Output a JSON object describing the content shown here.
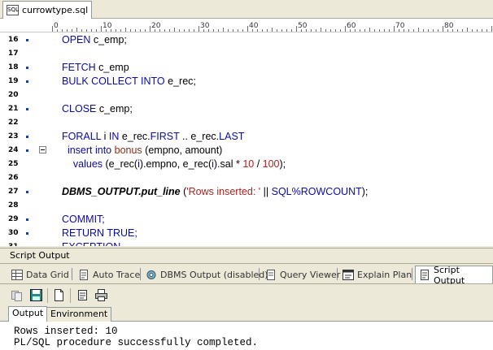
{
  "file_tab": {
    "icon": "sql-file-icon",
    "icon_text": "SQL",
    "label": "currowtype.sql"
  },
  "ruler": {
    "marks": [
      "0",
      "10",
      "20",
      "30",
      "40",
      "50",
      "60",
      "70",
      "80"
    ]
  },
  "editor": {
    "lines": [
      {
        "num": "16",
        "marker": true,
        "fold": false,
        "tokens": [
          {
            "t": "OPEN ",
            "c": "kw"
          },
          {
            "t": "c_emp;",
            "c": "tx"
          }
        ]
      },
      {
        "num": "17",
        "marker": false,
        "fold": false,
        "tokens": []
      },
      {
        "num": "18",
        "marker": true,
        "fold": false,
        "tokens": [
          {
            "t": "FETCH ",
            "c": "kw"
          },
          {
            "t": "c_emp",
            "c": "tx"
          }
        ]
      },
      {
        "num": "19",
        "marker": true,
        "fold": false,
        "tokens": [
          {
            "t": "BULK COLLECT INTO ",
            "c": "kw"
          },
          {
            "t": "e_rec;",
            "c": "tx"
          }
        ]
      },
      {
        "num": "20",
        "marker": false,
        "fold": false,
        "tokens": []
      },
      {
        "num": "21",
        "marker": true,
        "fold": false,
        "tokens": [
          {
            "t": "CLOSE ",
            "c": "kw"
          },
          {
            "t": "c_emp;",
            "c": "tx"
          }
        ]
      },
      {
        "num": "22",
        "marker": false,
        "fold": false,
        "tokens": []
      },
      {
        "num": "23",
        "marker": true,
        "fold": false,
        "tokens": [
          {
            "t": "FORALL ",
            "c": "kw"
          },
          {
            "t": "i ",
            "c": "tx"
          },
          {
            "t": "IN ",
            "c": "kw"
          },
          {
            "t": "e_rec.",
            "c": "tx"
          },
          {
            "t": "FIRST",
            "c": "kw"
          },
          {
            "t": " .. e_rec.",
            "c": "tx"
          },
          {
            "t": "LAST",
            "c": "kw"
          }
        ]
      },
      {
        "num": "24",
        "marker": true,
        "fold": true,
        "tokens": [
          {
            "t": "  insert into ",
            "c": "kw"
          },
          {
            "t": "bonus",
            "c": "fn"
          },
          {
            "t": " (empno, amount)",
            "c": "tx"
          }
        ]
      },
      {
        "num": "25",
        "marker": false,
        "fold": false,
        "tokens": [
          {
            "t": "    values ",
            "c": "kw"
          },
          {
            "t": "(e_rec(",
            "c": "tx"
          },
          {
            "t": "i",
            "c": "kw"
          },
          {
            "t": ").empno, e_rec(",
            "c": "tx"
          },
          {
            "t": "i",
            "c": "kw"
          },
          {
            "t": ").sal * ",
            "c": "tx"
          },
          {
            "t": "10",
            "c": "rd"
          },
          {
            "t": " / ",
            "c": "tx"
          },
          {
            "t": "100",
            "c": "rd"
          },
          {
            "t": ");",
            "c": "tx"
          }
        ]
      },
      {
        "num": "26",
        "marker": false,
        "fold": false,
        "tokens": []
      },
      {
        "num": "27",
        "marker": true,
        "fold": false,
        "tokens": [
          {
            "t": "DBMS_OUTPUT.put_line",
            "c": "bi"
          },
          {
            "t": " (",
            "c": "tx"
          },
          {
            "t": "'Rows inserted: '",
            "c": "rd"
          },
          {
            "t": " || ",
            "c": "tx"
          },
          {
            "t": "SQL%ROWCOUNT",
            "c": "kw"
          },
          {
            "t": ");",
            "c": "tx"
          }
        ]
      },
      {
        "num": "28",
        "marker": false,
        "fold": false,
        "tokens": []
      },
      {
        "num": "29",
        "marker": true,
        "fold": false,
        "tokens": [
          {
            "t": "COMMIT;",
            "c": "kw"
          }
        ]
      },
      {
        "num": "30",
        "marker": true,
        "fold": false,
        "tokens": [
          {
            "t": "RETURN TRUE;",
            "c": "kw"
          }
        ]
      },
      {
        "num": "31",
        "marker": false,
        "fold": false,
        "tokens": [
          {
            "t": "EXCEPTION",
            "c": "kw"
          }
        ]
      }
    ]
  },
  "panel": {
    "title": "Script Output"
  },
  "tool_tabs": [
    {
      "label": "Data Grid",
      "icon": "data-grid-icon",
      "active": false
    },
    {
      "label": "Auto Trace",
      "icon": "auto-trace-icon",
      "active": false
    },
    {
      "label": "DBMS Output (disabled)",
      "icon": "dbms-output-icon",
      "active": false
    },
    {
      "label": "Query Viewer",
      "icon": "query-viewer-icon",
      "active": false
    },
    {
      "label": "Explain Plan",
      "icon": "explain-plan-icon",
      "active": false
    },
    {
      "label": "Script Output",
      "icon": "script-output-icon",
      "active": true
    }
  ],
  "toolbar": {
    "buttons": [
      "copy-icon",
      "save-output-icon",
      "new-document-icon",
      "clear-icon",
      "print-icon"
    ]
  },
  "output_tabs": [
    {
      "label": "Output",
      "active": true
    },
    {
      "label": "Environment",
      "active": false
    }
  ],
  "output": {
    "lines": [
      "Rows inserted: 10",
      "PL/SQL procedure successfully completed."
    ]
  },
  "colors": {
    "keyword": "#0a0aa8",
    "literal": "#b21f1f",
    "chrome": "#ece9d8",
    "marker": "#1a3f9a"
  }
}
